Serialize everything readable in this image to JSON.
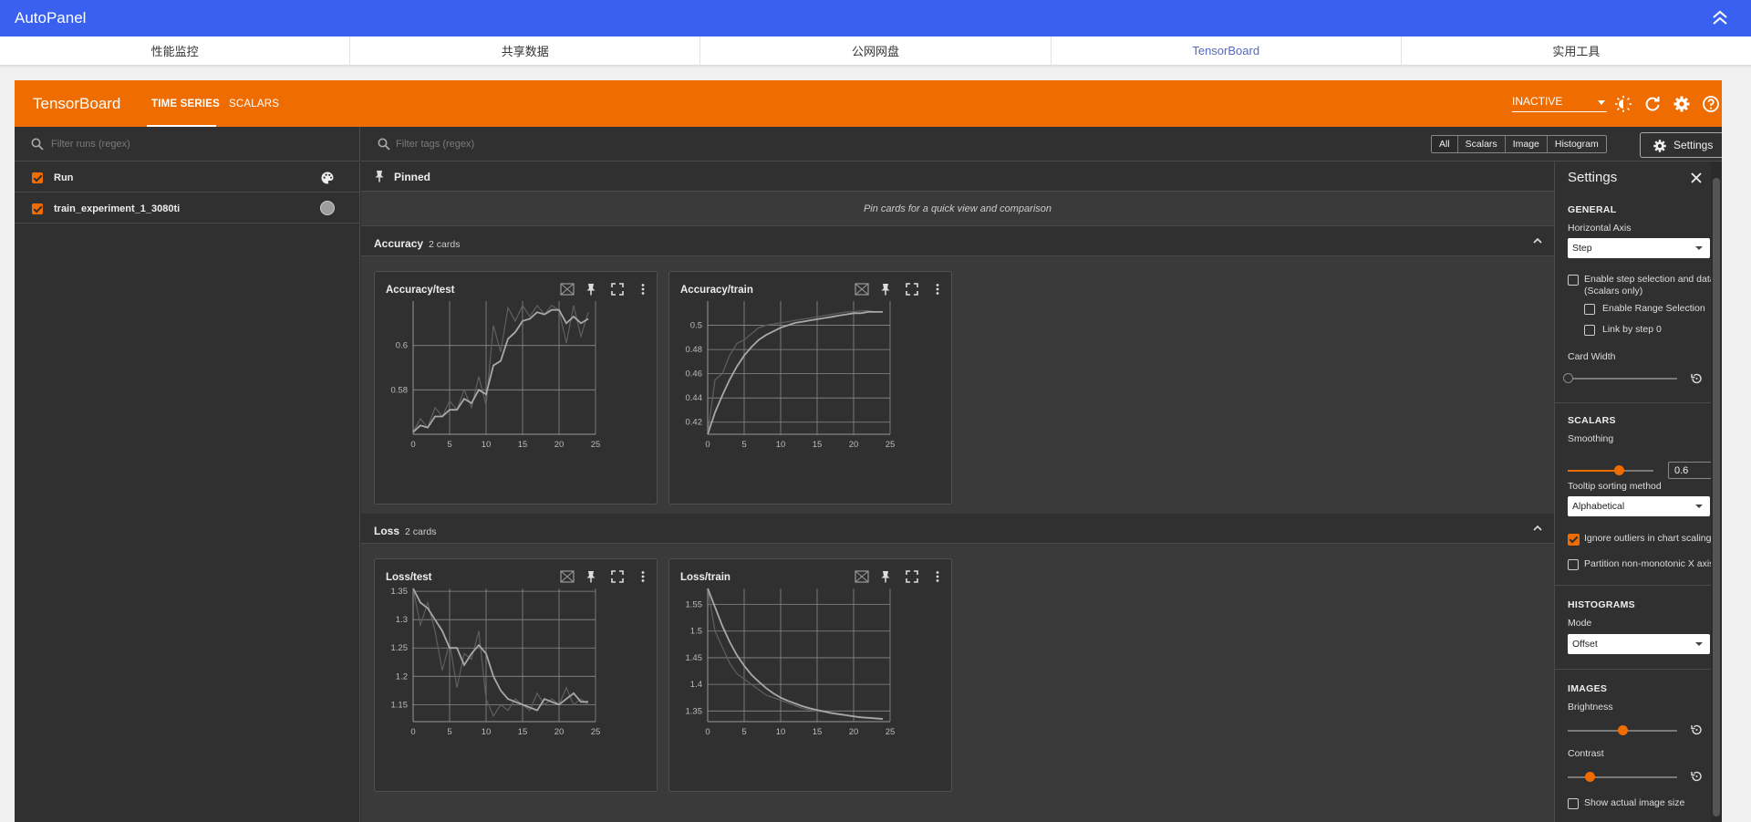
{
  "app": {
    "title": "AutoPanel"
  },
  "nav": [
    {
      "label": "性能监控"
    },
    {
      "label": "共享数据"
    },
    {
      "label": "公网网盘"
    },
    {
      "label": "TensorBoard"
    },
    {
      "label": "实用工具"
    }
  ],
  "tb": {
    "brand": "TensorBoard",
    "tabs": [
      "TIME SERIES",
      "SCALARS"
    ],
    "status": "INACTIVE"
  },
  "sidebar": {
    "filter_placeholder": "Filter runs (regex)",
    "runs": [
      {
        "label": "Run",
        "checked": true
      },
      {
        "label": "train_experiment_1_3080ti",
        "checked": true,
        "color": "#9e9e9e"
      }
    ]
  },
  "toolbar": {
    "filter_placeholder": "Filter tags (regex)",
    "types": [
      "All",
      "Scalars",
      "Image",
      "Histogram"
    ],
    "settings_label": "Settings"
  },
  "pinned": {
    "title": "Pinned",
    "empty_text": "Pin cards for a quick view and comparison"
  },
  "groups": [
    {
      "name": "Accuracy",
      "count": "2 cards"
    },
    {
      "name": "Loss",
      "count": "2 cards"
    }
  ],
  "settings": {
    "title": "Settings",
    "general": {
      "title": "GENERAL",
      "horizontal_axis_label": "Horizontal Axis",
      "horizontal_axis_value": "Step",
      "step_selection_label": "Enable step selection and data table",
      "step_selection_sub": "(Scalars only)",
      "range_selection_label": "Enable Range Selection",
      "link_step0_label": "Link by step 0",
      "card_width_label": "Card Width",
      "card_width_level": 0
    },
    "scalars": {
      "title": "SCALARS",
      "smoothing_label": "Smoothing",
      "smoothing_value": "0.6",
      "tooltip_label": "Tooltip sorting method",
      "tooltip_value": "Alphabetical",
      "ignore_outliers_label": "Ignore outliers in chart scaling",
      "ignore_outliers": true,
      "partition_label": "Partition non-monotonic X axis",
      "partition": false
    },
    "histograms": {
      "title": "HISTOGRAMS",
      "mode_label": "Mode",
      "mode_value": "Offset"
    },
    "images": {
      "title": "IMAGES",
      "brightness_label": "Brightness",
      "brightness_level": 0.5,
      "contrast_label": "Contrast",
      "contrast_level": 0.2,
      "show_actual_label": "Show actual image size"
    }
  },
  "chart_data": [
    {
      "type": "line",
      "title": "Accuracy/test",
      "xlim": [
        0,
        25
      ],
      "ylim": [
        0.56,
        0.62
      ],
      "xticks": [
        "0",
        "5",
        "10",
        "15",
        "20",
        "25"
      ],
      "yticks": [
        "0.58",
        "0.6"
      ],
      "series": [
        {
          "kind": "raw",
          "x": [
            0,
            1,
            2,
            3,
            4,
            5,
            6,
            7,
            8,
            9,
            10,
            11,
            12,
            13,
            14,
            15,
            16,
            17,
            18,
            19,
            20,
            21,
            22,
            23,
            24
          ],
          "y": [
            0.561,
            0.567,
            0.563,
            0.572,
            0.568,
            0.575,
            0.571,
            0.58,
            0.572,
            0.586,
            0.573,
            0.609,
            0.597,
            0.617,
            0.611,
            0.618,
            0.613,
            0.618,
            0.614,
            0.618,
            0.616,
            0.601,
            0.618,
            0.604,
            0.615
          ]
        },
        {
          "kind": "smoothed",
          "x": [
            0,
            1,
            2,
            3,
            4,
            5,
            6,
            7,
            8,
            9,
            10,
            11,
            12,
            13,
            14,
            15,
            16,
            17,
            18,
            19,
            20,
            21,
            22,
            23,
            24
          ],
          "y": [
            0.561,
            0.564,
            0.563,
            0.568,
            0.568,
            0.571,
            0.571,
            0.576,
            0.574,
            0.58,
            0.578,
            0.591,
            0.593,
            0.603,
            0.606,
            0.611,
            0.612,
            0.615,
            0.614,
            0.616,
            0.616,
            0.61,
            0.613,
            0.61,
            0.612
          ]
        }
      ]
    },
    {
      "type": "line",
      "title": "Accuracy/train",
      "xlim": [
        0,
        25
      ],
      "ylim": [
        0.41,
        0.52
      ],
      "xticks": [
        "0",
        "5",
        "10",
        "15",
        "20",
        "25"
      ],
      "yticks": [
        "0.42",
        "0.44",
        "0.46",
        "0.48",
        "0.5"
      ],
      "series": [
        {
          "kind": "raw",
          "x": [
            0,
            1,
            2,
            3,
            4,
            5,
            6,
            7,
            8,
            9,
            10,
            11,
            12,
            13,
            14,
            15,
            16,
            17,
            18,
            19,
            20,
            21,
            22,
            23,
            24
          ],
          "y": [
            0.41,
            0.455,
            0.46,
            0.475,
            0.485,
            0.488,
            0.493,
            0.498,
            0.5,
            0.501,
            0.502,
            0.503,
            0.504,
            0.505,
            0.506,
            0.507,
            0.508,
            0.509,
            0.51,
            0.511,
            0.511,
            0.512,
            0.512,
            0.511,
            0.511
          ]
        },
        {
          "kind": "smoothed",
          "x": [
            0,
            1,
            2,
            3,
            4,
            5,
            6,
            7,
            8,
            9,
            10,
            11,
            12,
            13,
            14,
            15,
            16,
            17,
            18,
            19,
            20,
            21,
            22,
            23,
            24
          ],
          "y": [
            0.41,
            0.428,
            0.442,
            0.455,
            0.466,
            0.475,
            0.482,
            0.488,
            0.492,
            0.495,
            0.498,
            0.5,
            0.502,
            0.503,
            0.504,
            0.505,
            0.506,
            0.507,
            0.508,
            0.509,
            0.51,
            0.51,
            0.511,
            0.511,
            0.511
          ]
        }
      ]
    },
    {
      "type": "line",
      "title": "Loss/test",
      "xlim": [
        0,
        25
      ],
      "ylim": [
        1.12,
        1.355
      ],
      "xticks": [
        "0",
        "5",
        "10",
        "15",
        "20",
        "25"
      ],
      "yticks": [
        "1.15",
        "1.2",
        "1.25",
        "1.3",
        "1.35"
      ],
      "series": [
        {
          "kind": "raw",
          "x": [
            0,
            1,
            2,
            3,
            4,
            5,
            6,
            7,
            8,
            9,
            10,
            11,
            12,
            13,
            14,
            15,
            16,
            17,
            18,
            19,
            20,
            21,
            22,
            23,
            24
          ],
          "y": [
            1.355,
            1.29,
            1.33,
            1.28,
            1.21,
            1.26,
            1.18,
            1.24,
            1.23,
            1.28,
            1.16,
            1.13,
            1.15,
            1.14,
            1.16,
            1.15,
            1.14,
            1.17,
            1.15,
            1.16,
            1.15,
            1.18,
            1.15,
            1.16,
            1.15
          ]
        },
        {
          "kind": "smoothed",
          "x": [
            0,
            1,
            2,
            3,
            4,
            5,
            6,
            7,
            8,
            9,
            10,
            11,
            12,
            13,
            14,
            15,
            16,
            17,
            18,
            19,
            20,
            21,
            22,
            23,
            24
          ],
          "y": [
            1.355,
            1.33,
            1.32,
            1.3,
            1.28,
            1.25,
            1.25,
            1.22,
            1.24,
            1.255,
            1.24,
            1.2,
            1.175,
            1.16,
            1.155,
            1.15,
            1.145,
            1.14,
            1.16,
            1.155,
            1.15,
            1.16,
            1.17,
            1.155,
            1.155
          ]
        }
      ]
    },
    {
      "type": "line",
      "title": "Loss/train",
      "xlim": [
        0,
        25
      ],
      "ylim": [
        1.33,
        1.58
      ],
      "xticks": [
        "0",
        "5",
        "10",
        "15",
        "20",
        "25"
      ],
      "yticks": [
        "1.35",
        "1.4",
        "1.45",
        "1.5",
        "1.55"
      ],
      "series": [
        {
          "kind": "raw",
          "x": [
            0,
            1,
            2,
            3,
            4,
            5,
            6,
            7,
            8,
            9,
            10,
            11,
            12,
            13,
            14,
            15,
            16,
            17,
            18,
            19,
            20,
            21,
            22,
            23,
            24
          ],
          "y": [
            1.58,
            1.5,
            1.47,
            1.44,
            1.42,
            1.41,
            1.4,
            1.39,
            1.38,
            1.375,
            1.37,
            1.365,
            1.36,
            1.355,
            1.352,
            1.35,
            1.348,
            1.346,
            1.344,
            1.342,
            1.34,
            1.339,
            1.338,
            1.337,
            1.336
          ]
        },
        {
          "kind": "smoothed",
          "x": [
            0,
            1,
            2,
            3,
            4,
            5,
            6,
            7,
            8,
            9,
            10,
            11,
            12,
            13,
            14,
            15,
            16,
            17,
            18,
            19,
            20,
            21,
            22,
            23,
            24
          ],
          "y": [
            1.58,
            1.545,
            1.51,
            1.48,
            1.455,
            1.435,
            1.418,
            1.405,
            1.393,
            1.383,
            1.375,
            1.369,
            1.364,
            1.359,
            1.355,
            1.352,
            1.349,
            1.346,
            1.344,
            1.342,
            1.34,
            1.338,
            1.337,
            1.336,
            1.335
          ]
        }
      ]
    }
  ]
}
